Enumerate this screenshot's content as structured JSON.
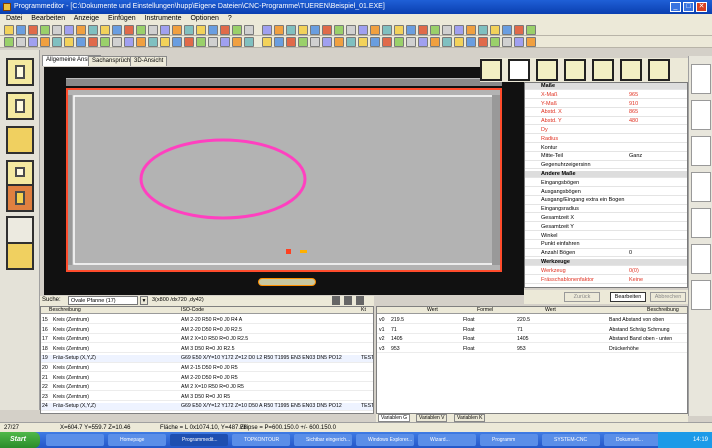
{
  "window": {
    "title": "Programmeditor - [C:\\Dokumente und Einstellungen\\hupp\\Eigene Dateien\\CNC-Programme\\TUEREN\\Beispiel_01.EXE]",
    "minimize": "_",
    "maximize": "□",
    "close": "✕"
  },
  "menu": [
    "Datei",
    "Bearbeiten",
    "Anzeige",
    "Einfügen",
    "Instrumente",
    "Optionen",
    "?"
  ],
  "tabs": [
    "Allgemeine Ansicht",
    "Sachansprüche",
    "3D-Ansicht"
  ],
  "properties": {
    "rows": [
      {
        "k": "Maße",
        "v": "",
        "cat": true
      },
      {
        "k": "X-Maß",
        "v": "965",
        "red": true
      },
      {
        "k": "Y-Maß",
        "v": "910",
        "red": true
      },
      {
        "k": "Abstd. X",
        "v": "865",
        "red": true
      },
      {
        "k": "Abstd. Y",
        "v": "480",
        "red": true
      },
      {
        "k": "Dy",
        "v": "",
        "red": true
      },
      {
        "k": "Radius",
        "v": "",
        "red": true
      },
      {
        "k": "Kontur",
        "v": "",
        "red": false
      },
      {
        "k": "Mitte-Teil",
        "v": "Ganz",
        "red": false
      },
      {
        "k": "Gegenuhrzeigersinn",
        "v": "",
        "red": false
      },
      {
        "k": "Andere Maße",
        "v": "",
        "cat": true
      },
      {
        "k": "Eingangsbögen",
        "v": "",
        "red": false
      },
      {
        "k": "Ausgangsbögen",
        "v": "",
        "red": false
      },
      {
        "k": "Ausgang/Eingang extra ein Bogen",
        "v": "",
        "red": false
      },
      {
        "k": "Eingangsradius",
        "v": "",
        "red": false
      },
      {
        "k": "Gesamtzeit X",
        "v": "",
        "red": false
      },
      {
        "k": "Gesamtzeit Y",
        "v": "",
        "red": false
      },
      {
        "k": "Winkel",
        "v": "",
        "red": false
      },
      {
        "k": "Punkt einfahren",
        "v": "",
        "red": false
      },
      {
        "k": "Anzahl Bögen",
        "v": "0",
        "red": false
      },
      {
        "k": "Werkzeuge",
        "v": "",
        "cat": true
      },
      {
        "k": "Werkzeug",
        "v": "0(0)",
        "red": true
      },
      {
        "k": "Frässchablonenfaktor",
        "v": "Keine",
        "red": true
      }
    ],
    "btn_ok": "Bearbeiten",
    "btn_cancel": "Abbrechen",
    "btn_prev": "Zurück"
  },
  "bottom_left": {
    "dropdown_label": "Suche:",
    "dropdown_value": "Ovale Pfanne (17)",
    "coord": "3(x800 /dx720 ,dy42)",
    "columns": [
      "Beschreibung",
      "ISO-Code",
      "Kt"
    ],
    "rows": [
      {
        "n": "15",
        "desc": "Kreis (Zentrum)",
        "code": "AM 2-20 R50 R=0 J0 R4 A",
        "kt": ""
      },
      {
        "n": "16",
        "desc": "Kreis (Zentrum)",
        "code": "AM 2-20 D50 R=0 J0 R2.5",
        "kt": ""
      },
      {
        "n": "17",
        "desc": "Kreis (Zentrum)",
        "code": "AM 2 X=10 R50 R=0 J0 R2.5",
        "kt": ""
      },
      {
        "n": "18",
        "desc": "Kreis (Zentrum)",
        "code": "AM 3 D50 R=0 J0 R2.5",
        "kt": ""
      },
      {
        "n": "19",
        "desc": "Fräs-Setup (X,Y,Z)",
        "code": "G69 E50 X/Y=10 Y172 Z=12 D0 L2 R50 T1995 EN3 EN03 DN5 PO12",
        "kt": "TEST_5c"
      },
      {
        "n": "20",
        "desc": "Kreis (Zentrum)",
        "code": "AM 2-15 D50 R=0 J0 R5",
        "kt": ""
      },
      {
        "n": "21",
        "desc": "Kreis (Zentrum)",
        "code": "AM 2-20 D50 R=0 J0 R5",
        "kt": ""
      },
      {
        "n": "22",
        "desc": "Kreis (Zentrum)",
        "code": "AM 2 X=10 R50 R=0 J0 R5",
        "kt": ""
      },
      {
        "n": "23",
        "desc": "Kreis (Zentrum)",
        "code": "AM 3 D50 R=0 J0 R5",
        "kt": ""
      },
      {
        "n": "24",
        "desc": "Fräs-Setup (X,Y,Z)",
        "code": "G69 E50 X/Y=12 Y172 Z=10 D50 A R50 T1995 EN5 EN03 DN5 PO12",
        "kt": "TEST_5c"
      }
    ]
  },
  "bottom_right": {
    "columns": [
      "",
      "Wert",
      "Formel",
      "Wert",
      "Beschreibung"
    ],
    "rows": [
      {
        "n": "v0",
        "val": "219.5",
        "formel": "Float",
        "wert": "220.5",
        "desc": "Band Abstand von oben"
      },
      {
        "n": "v1",
        "val": "71",
        "formel": "Float",
        "wert": "71",
        "desc": "Abstand Schräg Schrnung"
      },
      {
        "n": "v2",
        "val": "1405",
        "formel": "Float",
        "wert": "1405",
        "desc": "Abstand Band oben - unten"
      },
      {
        "n": "v3",
        "val": "953",
        "formel": "Float",
        "wert": "953",
        "desc": "Drückerhöhe"
      }
    ],
    "tabs": [
      "Variablen G",
      "Variablen V",
      "Variablen K"
    ]
  },
  "status": {
    "left": "27/27",
    "coord": "X=604.7 Y=559.7 Z=10.46",
    "info": "Fläche = L 0x1074.10, Y=487.78",
    "ellipse": "Ellipse = P=600.150.0 +/- 600.150.0"
  },
  "taskbar": {
    "start": "Start",
    "tasks": [
      "",
      "Homepage",
      "Programmedit...",
      "TOPKONTOUR",
      "Sichtbar eingerich...",
      "Windows Explorer...",
      "Wizard...",
      "Programm",
      "SYSTEM-CNC",
      "Dokument..."
    ],
    "clock": "14:19"
  }
}
